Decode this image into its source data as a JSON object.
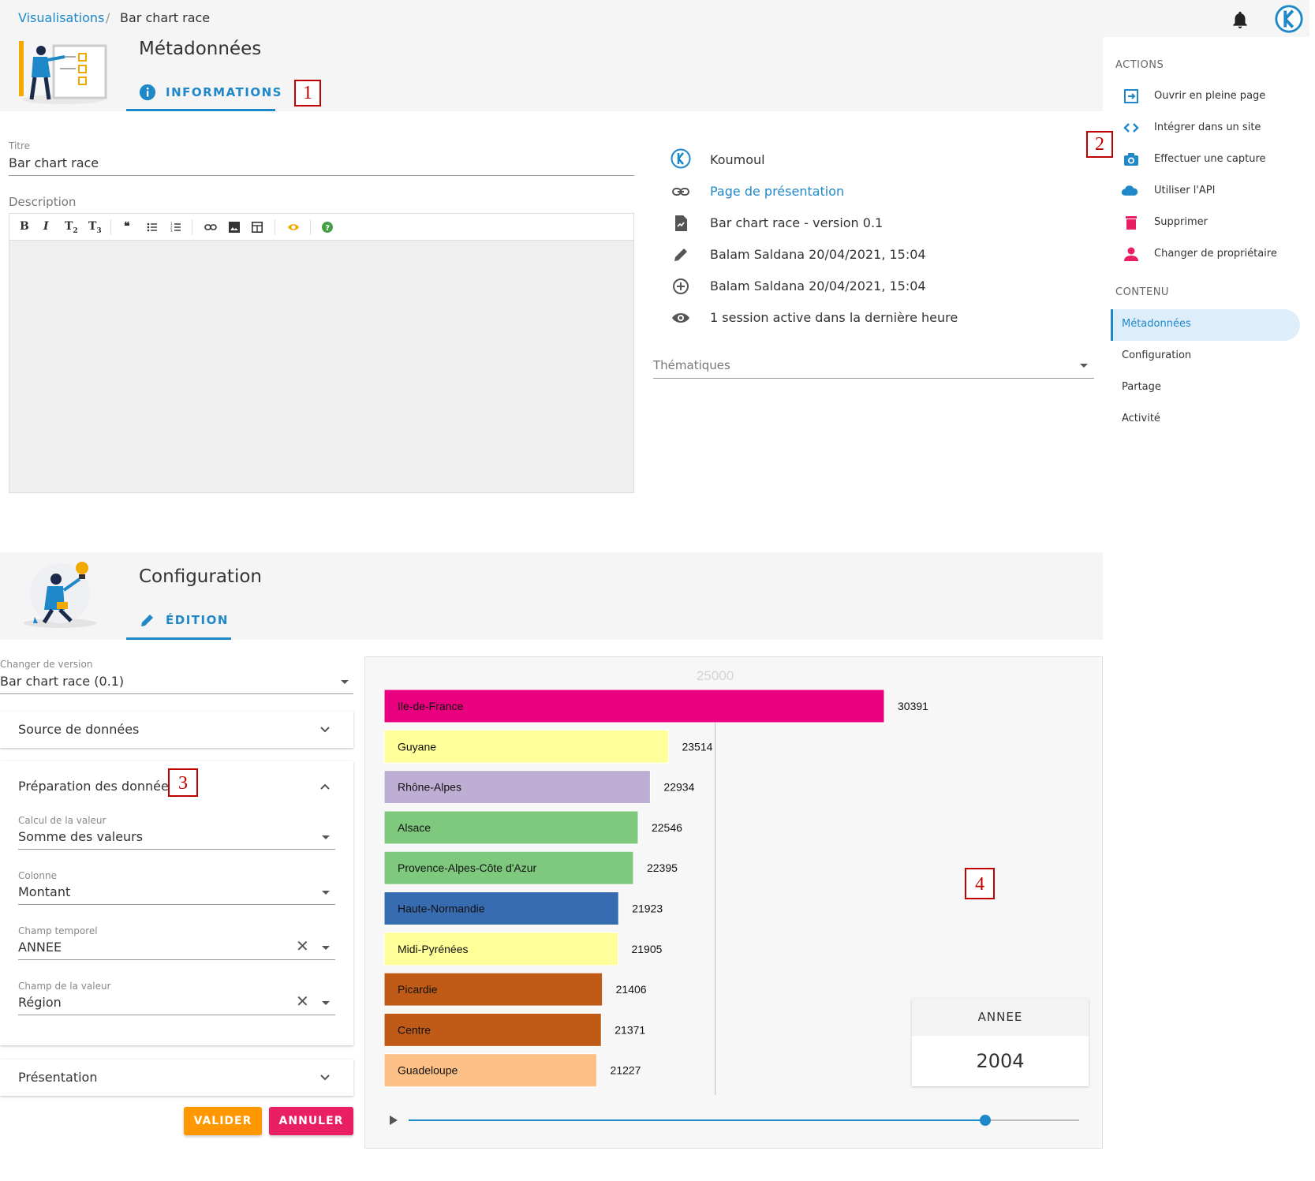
{
  "breadcrumb": {
    "parent": "Visualisations",
    "separator": "/",
    "current": "Bar chart race"
  },
  "metadata": {
    "title": "Métadonnées",
    "tab_label": "INFORMATIONS",
    "titre_label": "Titre",
    "titre_value": "Bar chart race",
    "description_label": "Description",
    "thematiques_placeholder": "Thématiques"
  },
  "info_list": {
    "owner": "Koumoul",
    "presentation_link": "Page de présentation",
    "version": "Bar chart race - version 0.1",
    "updated": "Balam Saldana 20/04/2021, 15:04",
    "created": "Balam Saldana 20/04/2021, 15:04",
    "sessions": "1 session active dans la dernière heure"
  },
  "side_menu": {
    "actions_heading": "ACTIONS",
    "actions": [
      "Ouvrir en pleine page",
      "Intégrer dans un site",
      "Effectuer une capture",
      "Utiliser l'API",
      "Supprimer",
      "Changer de propriétaire"
    ],
    "content_heading": "CONTENU",
    "content": [
      "Métadonnées",
      "Configuration",
      "Partage",
      "Activité"
    ],
    "active_item": "Métadonnées"
  },
  "config": {
    "title": "Configuration",
    "tab_label": "ÉDITION",
    "version_label": "Changer de version",
    "version_value": "Bar chart race (0.1)",
    "source_label": "Source de données",
    "prep_label": "Préparation des données",
    "calc_label": "Calcul de la valeur",
    "calc_value": "Somme des valeurs",
    "colonne_label": "Colonne",
    "colonne_value": "Montant",
    "temporel_label": "Champ temporel",
    "temporel_value": "ANNEE",
    "valeur_label": "Champ de la valeur",
    "valeur_value": "Région",
    "presentation_label": "Présentation",
    "validate_label": "VALIDER",
    "cancel_label": "ANNULER"
  },
  "callouts": [
    "1",
    "2",
    "3",
    "4"
  ],
  "year_panel": {
    "label": "ANNEE",
    "value": "2004"
  },
  "slider": {
    "position": 0.86
  },
  "colors": {
    "accent": "#1e88c9",
    "validate": "#ff9800",
    "cancel": "#e91e63",
    "delete": "#e91e63"
  },
  "chart_data": {
    "type": "bar",
    "orientation": "horizontal",
    "x_ticks": [
      10000,
      25000
    ],
    "xlim": [
      0,
      35000
    ],
    "categories": [
      "Ile-de-France",
      "Guyane",
      "Rhône-Alpes",
      "Alsace",
      "Provence-Alpes-Côte d'Azur",
      "Haute-Normandie",
      "Midi-Pyrénées",
      "Picardie",
      "Centre",
      "Guadeloupe"
    ],
    "values": [
      30391,
      23514,
      22934,
      22546,
      22395,
      21923,
      21905,
      21406,
      21371,
      21227
    ],
    "bar_colors": [
      "#e8007e",
      "#ffff99",
      "#beaed4",
      "#7fc97f",
      "#7fc97f",
      "#386cb0",
      "#ffff99",
      "#bf5b17",
      "#bf5b17",
      "#fdc086"
    ]
  }
}
